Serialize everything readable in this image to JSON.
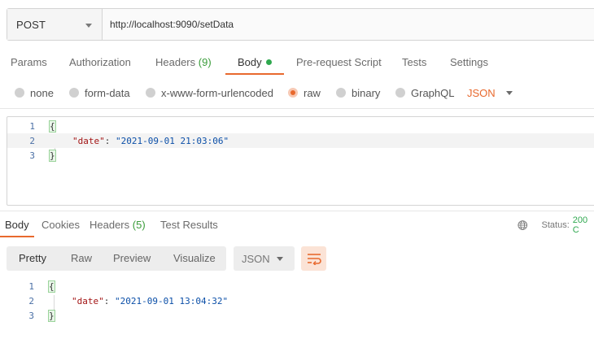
{
  "request": {
    "method": "POST",
    "url": "http://localhost:9090/setData"
  },
  "request_tabs": {
    "params": "Params",
    "authorization": "Authorization",
    "headers": "Headers",
    "headers_count": "(9)",
    "body": "Body",
    "prerequest": "Pre-request Script",
    "tests": "Tests",
    "settings": "Settings"
  },
  "body_types": {
    "none": "none",
    "form_data": "form-data",
    "urlencoded": "x-www-form-urlencoded",
    "raw": "raw",
    "binary": "binary",
    "graphql": "GraphQL",
    "selected": "raw",
    "language": "JSON"
  },
  "request_body": {
    "line_numbers": [
      "1",
      "2",
      "3"
    ],
    "open_brace": "{",
    "key": "\"date\"",
    "colon": ": ",
    "value": "\"2021-09-01 21:03:06\"",
    "close_brace": "}"
  },
  "response_tabs": {
    "body": "Body",
    "cookies": "Cookies",
    "headers": "Headers",
    "headers_count": "(5)",
    "test_results": "Test Results",
    "status_label": "Status:",
    "status_code": "200 C"
  },
  "response_toolbar": {
    "pretty": "Pretty",
    "raw": "Raw",
    "preview": "Preview",
    "visualize": "Visualize",
    "format": "JSON"
  },
  "response_body": {
    "line_numbers": [
      "1",
      "2",
      "3"
    ],
    "open_brace": "{",
    "key": "\"date\"",
    "colon": ": ",
    "value": "\"2021-09-01 13:04:32\"",
    "close_brace": "}"
  },
  "colors": {
    "accent": "#e8692e",
    "success": "#2fa84f"
  }
}
